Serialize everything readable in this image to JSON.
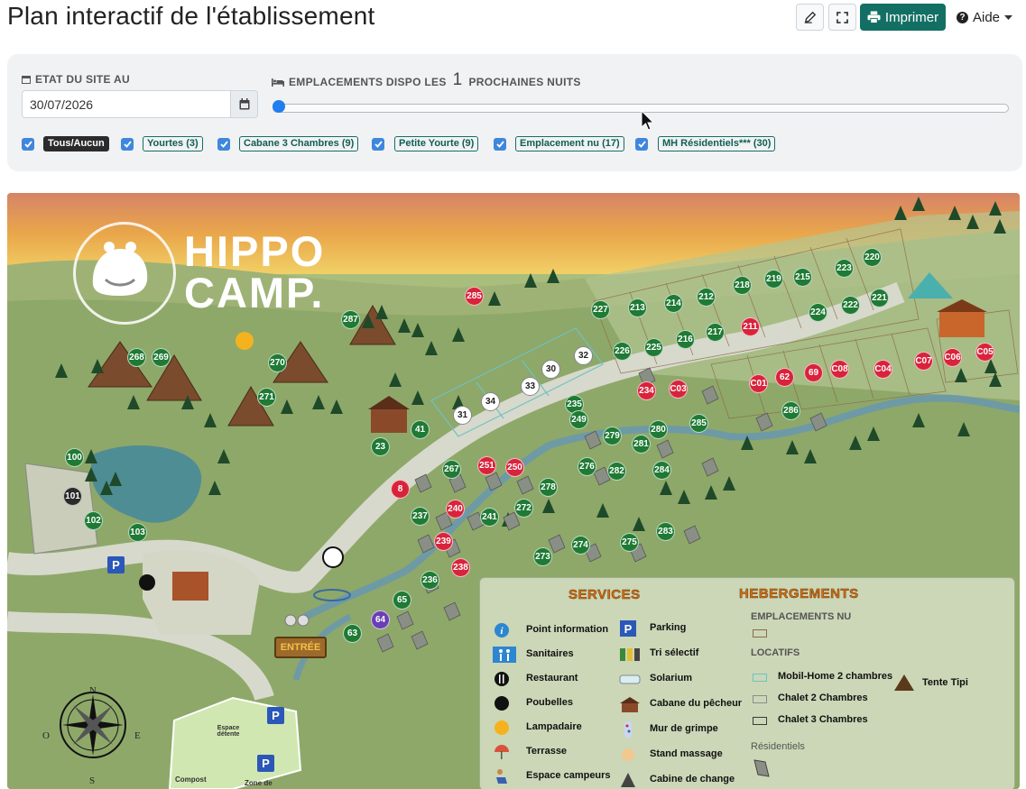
{
  "page": {
    "title": "Plan interactif de l'établissement"
  },
  "toolbar": {
    "edit_icon": "edit-icon",
    "fullscreen_icon": "expand-icon",
    "print_label": "Imprimer",
    "help_label": "Aide"
  },
  "filters": {
    "date_label": "ETAT DU SITE AU",
    "date_value": "30/07/2026",
    "nights_label_prefix": "EMPLACEMENTS DISPO LES",
    "nights_count": "1",
    "nights_label_suffix": "PROCHAINES NUITS",
    "slider_value": 1,
    "categories": [
      {
        "label": "Tous/Aucun",
        "checked": true
      },
      {
        "label": "Yourtes (3)",
        "checked": true
      },
      {
        "label": "Cabane 3 Chambres (9)",
        "checked": true
      },
      {
        "label": "Petite Yourte (9)",
        "checked": true
      },
      {
        "label": "Emplacement nu (17)",
        "checked": true
      },
      {
        "label": "MH Résidentiels*** (30)",
        "checked": true
      }
    ]
  },
  "map": {
    "logo_line1": "HIPPO",
    "logo_line2": "CAMP.",
    "entry_sign": "ENTRÉE",
    "compass": {
      "n": "N",
      "s": "S",
      "e": "E",
      "o": "O"
    },
    "areas": {
      "relax": "Espace détente",
      "compost": "Compost",
      "zone": "Zone de"
    },
    "pins": [
      {
        "n": "285",
        "c": "r"
      },
      {
        "n": "287",
        "c": "g"
      },
      {
        "n": "268",
        "c": "g"
      },
      {
        "n": "269",
        "c": "g"
      },
      {
        "n": "270",
        "c": "g"
      },
      {
        "n": "271",
        "c": "g"
      },
      {
        "n": "227",
        "c": "g"
      },
      {
        "n": "213",
        "c": "g"
      },
      {
        "n": "214",
        "c": "g"
      },
      {
        "n": "212",
        "c": "g"
      },
      {
        "n": "218",
        "c": "g"
      },
      {
        "n": "219",
        "c": "g"
      },
      {
        "n": "215",
        "c": "g"
      },
      {
        "n": "223",
        "c": "g"
      },
      {
        "n": "220",
        "c": "g"
      },
      {
        "n": "224",
        "c": "g"
      },
      {
        "n": "222",
        "c": "g"
      },
      {
        "n": "221",
        "c": "g"
      },
      {
        "n": "226",
        "c": "g"
      },
      {
        "n": "225",
        "c": "g"
      },
      {
        "n": "216",
        "c": "g"
      },
      {
        "n": "217",
        "c": "g"
      },
      {
        "n": "211",
        "c": "r"
      },
      {
        "n": "32",
        "c": "w"
      },
      {
        "n": "30",
        "c": "w"
      },
      {
        "n": "33",
        "c": "w"
      },
      {
        "n": "34",
        "c": "w"
      },
      {
        "n": "31",
        "c": "w"
      },
      {
        "n": "C01",
        "c": "r"
      },
      {
        "n": "62",
        "c": "r"
      },
      {
        "n": "69",
        "c": "r"
      },
      {
        "n": "C08",
        "c": "r"
      },
      {
        "n": "C04",
        "c": "r"
      },
      {
        "n": "C07",
        "c": "r"
      },
      {
        "n": "C06",
        "c": "r"
      },
      {
        "n": "C05",
        "c": "r"
      },
      {
        "n": "286",
        "c": "g"
      },
      {
        "n": "235",
        "c": "g"
      },
      {
        "n": "234",
        "c": "r"
      },
      {
        "n": "C03",
        "c": "r"
      },
      {
        "n": "249",
        "c": "g"
      },
      {
        "n": "279",
        "c": "g"
      },
      {
        "n": "280",
        "c": "g"
      },
      {
        "n": "285",
        "c": "g"
      },
      {
        "n": "281",
        "c": "g"
      },
      {
        "n": "41",
        "c": "g"
      },
      {
        "n": "23",
        "c": "g"
      },
      {
        "n": "267",
        "c": "g"
      },
      {
        "n": "251",
        "c": "r"
      },
      {
        "n": "250",
        "c": "r"
      },
      {
        "n": "276",
        "c": "g"
      },
      {
        "n": "282",
        "c": "g"
      },
      {
        "n": "284",
        "c": "g"
      },
      {
        "n": "278",
        "c": "g"
      },
      {
        "n": "8",
        "c": "r"
      },
      {
        "n": "240",
        "c": "r"
      },
      {
        "n": "241",
        "c": "g"
      },
      {
        "n": "272",
        "c": "g"
      },
      {
        "n": "237",
        "c": "g"
      },
      {
        "n": "239",
        "c": "r"
      },
      {
        "n": "238",
        "c": "r"
      },
      {
        "n": "273",
        "c": "g"
      },
      {
        "n": "274",
        "c": "g"
      },
      {
        "n": "275",
        "c": "g"
      },
      {
        "n": "283",
        "c": "g"
      },
      {
        "n": "236",
        "c": "g"
      },
      {
        "n": "65",
        "c": "g"
      },
      {
        "n": "64",
        "c": "p"
      },
      {
        "n": "63",
        "c": "g"
      },
      {
        "n": "100",
        "c": "g"
      },
      {
        "n": "101",
        "c": "k"
      },
      {
        "n": "102",
        "c": "g"
      },
      {
        "n": "103",
        "c": "g"
      }
    ]
  },
  "legend": {
    "services_title": "SERVICES",
    "services": [
      {
        "label": "Point information",
        "icon": "info-icon"
      },
      {
        "label": "Sanitaires",
        "icon": "restroom-icon"
      },
      {
        "label": "Restaurant",
        "icon": "cutlery-icon"
      },
      {
        "label": "Poubelles",
        "icon": "bin-dot-icon"
      },
      {
        "label": "Lampadaire",
        "icon": "lamp-dot-icon"
      },
      {
        "label": "Terrasse",
        "icon": "parasol-icon"
      },
      {
        "label": "Espace campeurs",
        "icon": "camper-icon"
      }
    ],
    "services2": [
      {
        "label": "Parking",
        "icon": "parking-icon"
      },
      {
        "label": "Tri sélectif",
        "icon": "recycling-icon"
      },
      {
        "label": "Solarium",
        "icon": "sunbed-icon"
      },
      {
        "label": "Cabane du pêcheur",
        "icon": "cabin-icon"
      },
      {
        "label": "Mur de grimpe",
        "icon": "climbing-wall-icon"
      },
      {
        "label": "Stand massage",
        "icon": "massage-icon"
      },
      {
        "label": "Cabine de change",
        "icon": "changing-cabin-icon"
      }
    ],
    "hebergements_title": "HEBERGEMENTS",
    "emplacements_nu": "EMPLACEMENTS NU",
    "locatifs": "LOCATIFS",
    "locatif_items": [
      {
        "label": "Mobil-Home 2 chambres",
        "color": "#6fc2c0"
      },
      {
        "label": "Chalet 2 Chambres",
        "color": "#8c8c8c"
      },
      {
        "label": "Chalet 3 Chambres",
        "color": "#3b3b3b"
      }
    ],
    "tipi": "Tente Tipi",
    "residentiels": "Résidentiels"
  }
}
